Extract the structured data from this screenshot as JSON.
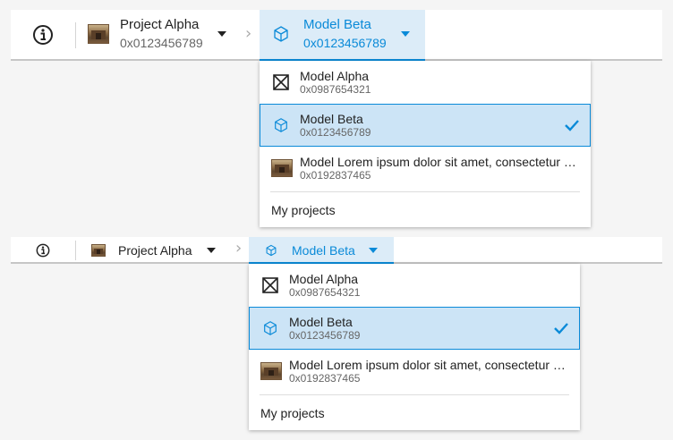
{
  "breadcrumb": {
    "project": {
      "title": "Project Alpha",
      "address": "0x0123456789"
    },
    "model": {
      "title": "Model Beta",
      "address": "0x0123456789"
    }
  },
  "menu": {
    "items": [
      {
        "name": "Model Alpha",
        "address": "0x0987654321",
        "icon": "no-thumbnail-icon",
        "selected": false
      },
      {
        "name": "Model Beta",
        "address": "0x0123456789",
        "icon": "cube-icon",
        "selected": true
      },
      {
        "name": "Model Lorem ipsum dolor sit amet, consectetur adipiscing elit",
        "address": "0x0192837465",
        "icon": "project-thumbnail",
        "selected": false
      }
    ],
    "footer": "My projects"
  },
  "colors": {
    "accent": "#0a8ad8",
    "selected_bg": "#cce4f6",
    "active_bg": "#dcecf8"
  }
}
